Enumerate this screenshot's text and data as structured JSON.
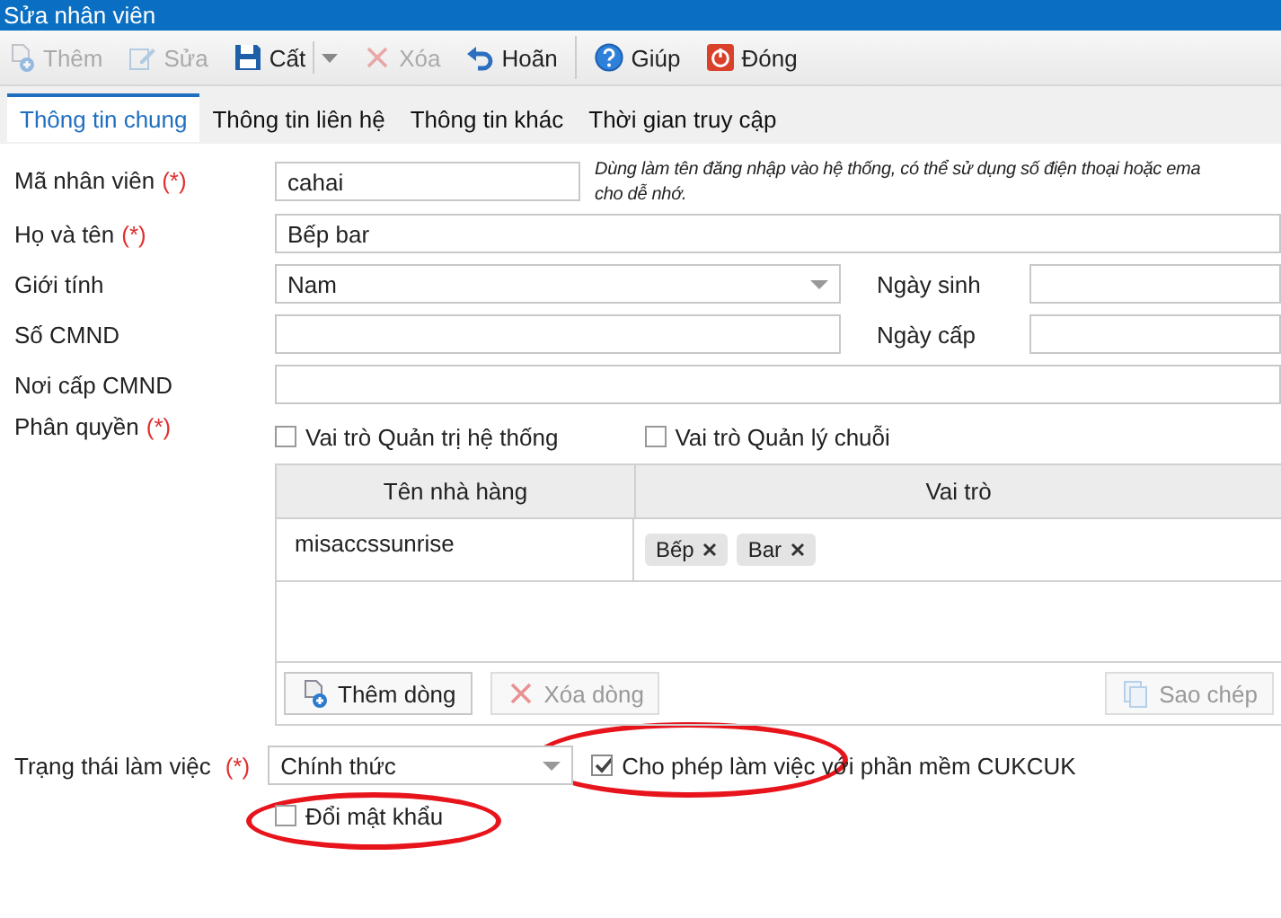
{
  "window": {
    "title": "Sửa nhân viên"
  },
  "toolbar": [
    {
      "label": "Thêm",
      "kind": "add",
      "disabled": true,
      "group_start": false,
      "dropdown": false
    },
    {
      "label": "Sửa",
      "kind": "edit",
      "disabled": true,
      "group_start": false,
      "dropdown": false
    },
    {
      "label": "Cất",
      "kind": "save",
      "disabled": false,
      "group_start": false,
      "dropdown": true
    },
    {
      "label": "Xóa",
      "kind": "delete",
      "disabled": true,
      "group_start": false,
      "dropdown": false
    },
    {
      "label": "Hoãn",
      "kind": "undo",
      "disabled": false,
      "group_start": false,
      "dropdown": false
    },
    {
      "label": "Giúp",
      "kind": "help",
      "disabled": false,
      "group_start": true,
      "dropdown": false
    },
    {
      "label": "Đóng",
      "kind": "close",
      "disabled": false,
      "group_start": false,
      "dropdown": false
    }
  ],
  "tabs": [
    {
      "label": "Thông tin chung",
      "selected": true
    },
    {
      "label": "Thông tin liên hệ",
      "selected": false
    },
    {
      "label": "Thông tin khác",
      "selected": false
    },
    {
      "label": "Thời gian truy cập",
      "selected": false
    }
  ],
  "form": {
    "employee_code": {
      "label": "Mã nhân viên",
      "required_mark": "(*)",
      "value": "cahai",
      "hint_lines": [
        "Dùng làm tên đăng nhập vào hệ thống, có thể sử dụng số điện thoại hoặc ema",
        "cho dễ nhớ."
      ]
    },
    "full_name": {
      "label": "Họ và tên",
      "required_mark": "(*)",
      "value": "Bếp bar"
    },
    "gender": {
      "label": "Giới tính",
      "value": "Nam"
    },
    "birth_date": {
      "label": "Ngày sinh"
    },
    "id_number": {
      "label": "Số CMND"
    },
    "issue_date": {
      "label": "Ngày cấp"
    },
    "issue_place": {
      "label": "Nơi cấp CMND"
    },
    "permissions": {
      "label": "Phân quyền",
      "required_mark": "(*)",
      "roles": [
        {
          "label": "Vai trò Quản trị hệ thống",
          "checked": false
        },
        {
          "label": "Vai trò Quản lý chuỗi",
          "checked": false
        }
      ],
      "table": {
        "columns": [
          "Tên nhà hàng",
          "Vai trò"
        ],
        "rows": [
          {
            "restaurant": "misaccssunrise",
            "roles": [
              "Bếp",
              "Bar"
            ]
          }
        ],
        "buttons": [
          {
            "label": "Thêm dòng",
            "kind": "add",
            "disabled": false
          },
          {
            "label": "Xóa dòng",
            "kind": "delete",
            "disabled": true
          },
          {
            "label": "Sao chép",
            "kind": "copy",
            "disabled": true
          }
        ]
      }
    },
    "work_status": {
      "label": "Trạng thái làm việc",
      "required_mark": "(*)",
      "value": "Chính thức"
    },
    "allow_cukcuk": {
      "label": "Cho phép làm việc với phần mềm CUKCUK",
      "checked": true
    },
    "change_password": {
      "label": "Đổi mật khẩu",
      "checked": false
    }
  }
}
